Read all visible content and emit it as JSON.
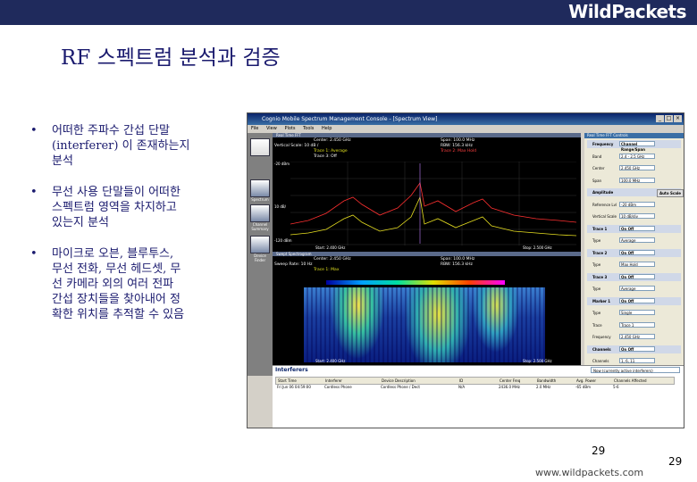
{
  "header": {
    "brand": "WildPackets"
  },
  "slide": {
    "title": "RF 스펙트럼 분석과 검증",
    "bullets": [
      "어떠한 주파수 간섭 단말\n(interferer) 이 존재하는지\n분석",
      "무선 사용 단말들이 어떠한\n스펙트럼 영역을 차지하고\n있는지 분석",
      "마이크로 오븐, 블루투스,\n무선 전화, 무선 헤드셋, 무\n선 카메라 외의 여러 전파\n간섭 장치들을 찾아내어 정\n확한 위치를 추적할 수 있음"
    ],
    "bullet_marker": "•",
    "page_number": "29",
    "url": "www.wildpackets.com",
    "page_number_corner": "29"
  },
  "screenshot": {
    "window_title": "Cognio Mobile Spectrum Management Console - [Spectrum View]",
    "menu": [
      "File",
      "View",
      "Plots",
      "Tools",
      "Help"
    ],
    "sidebar": [
      "Spectrum",
      "Channel\nSummary",
      "Device\nFinder"
    ],
    "plot1": {
      "panel_title": "Real Time FFT",
      "center": "Center: 2.450 GHz",
      "span": "Span: 100.0 MHz",
      "vscale": "Vertical Scale: 10 dB /",
      "rbw": "RBW: 156.3 kHz",
      "trace1": "Trace 1: Average",
      "trace2": "Trace 2: Max Hold",
      "trace3": "Trace 3: Off",
      "ref": "-20 dBm",
      "scale": "10 dB/",
      "floor": "-120 dBm",
      "start": "Start: 2.400 GHz",
      "stop": "Stop: 2.500 GHz"
    },
    "plot2": {
      "panel_title": "Swept Spectrogram",
      "center": "Center: 2.450 GHz",
      "span": "Span: 100.0 MHz",
      "sweep": "Sweep Rate: 10 Hz",
      "rbw": "RBW: 156.3 kHz",
      "trace": "Trace 1: Max",
      "start": "Start: 2.400 GHz",
      "stop": "Stop: 2.500 GHz"
    },
    "right_panel": {
      "title": "Real Time FFT Controls",
      "rows": [
        {
          "sec": "Frequency",
          "v": "Channel Range/Span"
        },
        {
          "k": "Band",
          "v": "2.4 - 2.5 GHz"
        },
        {
          "k": "Center",
          "v": "2.450 GHz"
        },
        {
          "k": "Span",
          "v": "100.0 MHz"
        },
        {
          "sec": "Amplitude",
          "btn": "Auto Scale"
        },
        {
          "k": "Reference Lvl",
          "v": "-20 dBm"
        },
        {
          "k": "Vertical Scale",
          "v": "10 dB/div"
        },
        {
          "sec": "Trace 1",
          "v": "On  Off"
        },
        {
          "k": "Type",
          "v": "Average"
        },
        {
          "sec": "Trace 2",
          "v": "On  Off"
        },
        {
          "k": "Type",
          "v": "Max Hold"
        },
        {
          "sec": "Trace 3",
          "v": "On  Off"
        },
        {
          "k": "Type",
          "v": "Average"
        },
        {
          "sec": "Marker 1",
          "v": "On  Off"
        },
        {
          "k": "Type",
          "v": "Single"
        },
        {
          "k": "Trace",
          "v": "Trace 1"
        },
        {
          "k": "Frequency",
          "v": "2.450 GHz"
        },
        {
          "sec": "Channels",
          "v": "On  Off"
        },
        {
          "k": "Channels",
          "v": "1, 6, 11"
        }
      ]
    },
    "interferers": {
      "title": "Interferers",
      "filter": "Now (currently active interferers)",
      "columns": [
        "Start Time",
        "Interferer",
        "Device Description",
        "ID",
        "Center Freq",
        "Bandwidth",
        "Avg. Power",
        "Channels Affected"
      ],
      "rows": [
        [
          "Fri Jun 06 04:59:00",
          "Cordless Phone",
          "Cordless Phone / Dect",
          "N/A",
          "2436.0 MHz",
          "2.0 MHz",
          "-65 dBm",
          "5-6"
        ]
      ]
    }
  }
}
